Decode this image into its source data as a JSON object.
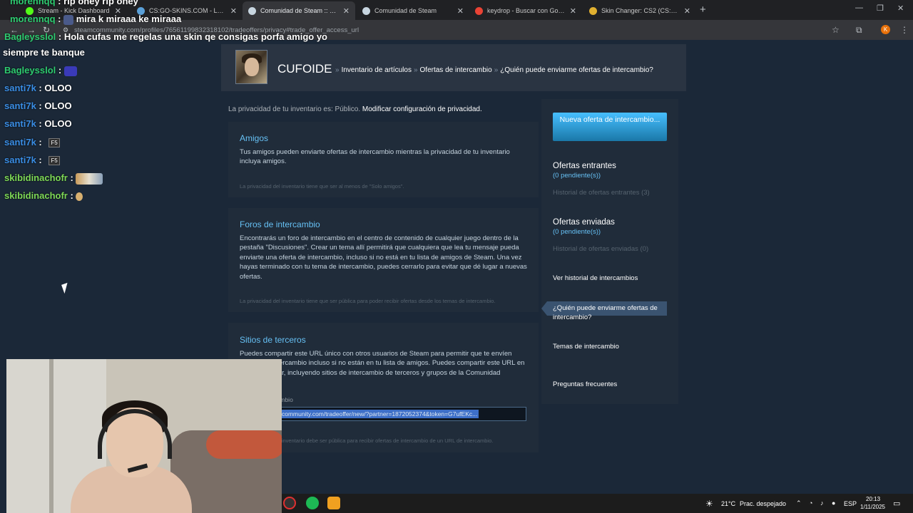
{
  "browser": {
    "tabs": [
      {
        "title": "Stream - Kick Dashboard",
        "active": false
      },
      {
        "title": "CS:GO-SKINS.COM - Los mejor",
        "active": false
      },
      {
        "title": "Comunidad de Steam :: ¿Quién",
        "active": true
      },
      {
        "title": "Comunidad de Steam",
        "active": false
      },
      {
        "title": "keydrop - Buscar con Google",
        "active": false
      },
      {
        "title": "Skin Changer: CS2 (CS:GO) Tra",
        "active": false
      }
    ],
    "url": "steamcommunity.com/profiles/76561199832318102/tradeoffers/privacy#trade_offer_access_url",
    "profile_initial": "K"
  },
  "steam": {
    "profile_name": "CUFOIDE",
    "breadcrumbs": [
      "Inventario de artículos",
      "Ofertas de intercambio",
      "¿Quién puede enviarme ofertas de intercambio?"
    ],
    "privacy_text": "La privacidad de tu inventario es: Público.",
    "privacy_link": "Modificar configuración de privacidad.",
    "sections": {
      "friends": {
        "title": "Amigos",
        "body": "Tus amigos pueden enviarte ofertas de intercambio mientras la privacidad de tu inventario incluya amigos.",
        "footer": "La privacidad del inventario tiene que ser al menos de \"Solo amigos\"."
      },
      "forums": {
        "title": "Foros de intercambio",
        "body": "Encontrarás un foro de intercambio en el centro de contenido de cualquier juego dentro de la pestaña \"Discusiones\". Crear un tema allí permitirá que cualquiera que lea tu mensaje pueda enviarte una oferta de intercambio, incluso si no está en tu lista de amigos de Steam. Una vez hayas terminado con tu tema de intercambio, puedes cerrarlo para evitar que dé lugar a nuevas ofertas.",
        "footer": "La privacidad del inventario tiene que ser pública para poder recibir ofertas desde los temas de intercambio."
      },
      "third_party": {
        "title": "Sitios de terceros",
        "body": "Puedes compartir este URL único con otros usuarios de Steam para permitir que te envíen ofertas de intercambio incluso si no están en tu lista de amigos. Puedes compartir este URL en cualquier lugar, incluyendo sitios de intercambio de terceros y grupos de la Comunidad",
        "url_label": "URL de intercambio",
        "url_value": "community.com/tradeoffer/new/?partner=1872052374&token=G7ufEKc...",
        "footer": "La privacidad del inventario debe ser pública para recibir ofertas de intercambio de un URL de intercambio."
      }
    },
    "sidebar": {
      "new_offer_button": "Nueva oferta de intercambio...",
      "incoming_title": "Ofertas entrantes",
      "incoming_pending": "(0 pendiente(s))",
      "incoming_history": "Historial de ofertas entrantes (3)",
      "sent_title": "Ofertas enviadas",
      "sent_pending": "(0 pendiente(s))",
      "sent_history": "Historial de ofertas enviadas (0)",
      "trade_history": "Ver historial de intercambios",
      "who_can_send": "¿Quién puede enviarme ofertas de intercambio?",
      "trade_topics": "Temas de intercambio",
      "faq": "Preguntas frecuentes"
    }
  },
  "chat": [
    {
      "user": "morennqq",
      "color": "#2ecc71",
      "msg": "rip oney rip oney"
    },
    {
      "user": "Bagleysslol",
      "color": "#2ecc71",
      "msg": "Hola cufas me regelas una skin qe consigas porfa amigo yo"
    },
    {
      "user": "",
      "color": "#ffffff",
      "msg": "siempre te banque"
    },
    {
      "user": "morennqq",
      "color": "#2ecc71",
      "msg": "mira k miraaa ke miraaa"
    },
    {
      "user": "Bagleysslol",
      "color": "#2ecc71",
      "msg": ""
    },
    {
      "user": "santi7k",
      "color": "#3a8ee6",
      "msg": "OLOO"
    },
    {
      "user": "santi7k",
      "color": "#3a8ee6",
      "msg": "OLOO"
    },
    {
      "user": "santi7k",
      "color": "#3a8ee6",
      "msg": "OLOO"
    },
    {
      "user": "santi7k",
      "color": "#3a8ee6",
      "msg": "F5"
    },
    {
      "user": "santi7k",
      "color": "#3a8ee6",
      "msg": "F5"
    },
    {
      "user": "skibidinachofr",
      "color": "#7ed957",
      "msg": ""
    },
    {
      "user": "skibidinachofr",
      "color": "#7ed957",
      "msg": ""
    }
  ],
  "taskbar": {
    "weather_temp": "21°C",
    "weather_desc": "Prac. despejado",
    "lang": "ESP",
    "time": "20:13",
    "date": "1/11/2025"
  },
  "colors": {
    "steam_bg": "#1b2838",
    "steam_link": "#66c0f4",
    "button_top": "#47bfff",
    "button_bottom": "#1a78a8"
  }
}
